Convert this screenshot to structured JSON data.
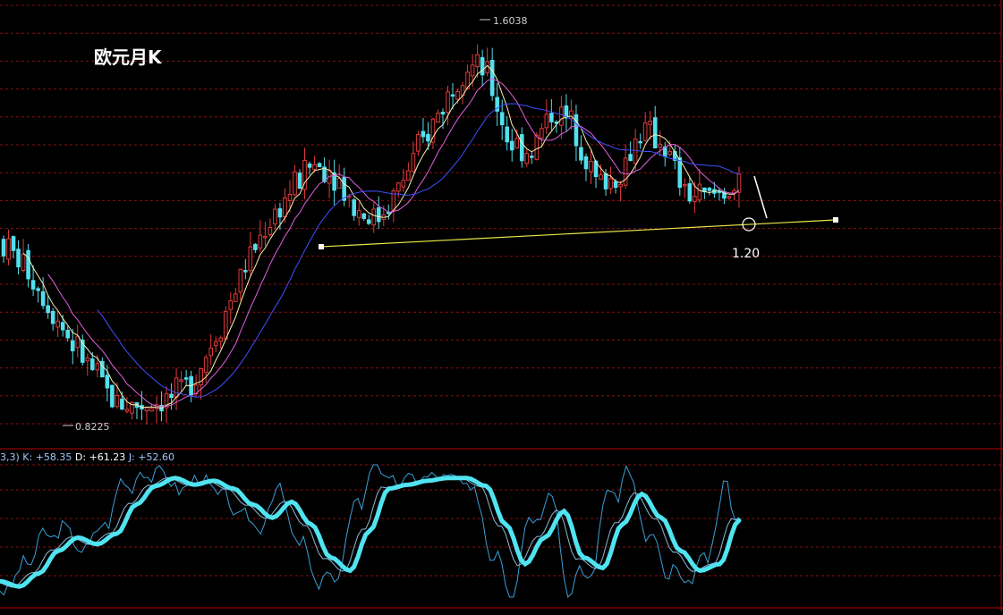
{
  "chart_data": [
    {
      "type": "candlestick",
      "title": "欧元月K",
      "ylim": [
        0.8,
        1.7
      ],
      "high_label": "1.6038",
      "low_label": "0.8225",
      "annotation_label": "1.20",
      "price_samples": [
        {
          "x": 0,
          "open": 1.18,
          "close": 1.16,
          "high": 1.2,
          "low": 1.12
        },
        {
          "x": 10,
          "open": 1.16,
          "close": 1.1,
          "high": 1.17,
          "low": 1.08
        },
        {
          "x": 20,
          "open": 1.1,
          "close": 1.02,
          "high": 1.12,
          "low": 1.0
        },
        {
          "x": 30,
          "open": 1.02,
          "close": 0.96,
          "high": 1.05,
          "low": 0.94
        },
        {
          "x": 40,
          "open": 0.96,
          "close": 0.9,
          "high": 0.98,
          "low": 0.86
        },
        {
          "x": 50,
          "open": 0.9,
          "close": 0.84,
          "high": 0.92,
          "low": 0.8225
        },
        {
          "x": 60,
          "open": 0.84,
          "close": 0.88,
          "high": 0.9,
          "low": 0.83
        },
        {
          "x": 70,
          "open": 0.88,
          "close": 0.86,
          "high": 0.9,
          "low": 0.84
        },
        {
          "x": 80,
          "open": 0.86,
          "close": 0.9,
          "high": 0.92,
          "low": 0.85
        },
        {
          "x": 90,
          "open": 0.9,
          "close": 0.98,
          "high": 1.0,
          "low": 0.88
        },
        {
          "x": 100,
          "open": 0.98,
          "close": 1.08,
          "high": 1.1,
          "low": 0.96
        },
        {
          "x": 110,
          "open": 1.08,
          "close": 1.18,
          "high": 1.2,
          "low": 1.06
        },
        {
          "x": 120,
          "open": 1.18,
          "close": 1.24,
          "high": 1.28,
          "low": 1.16
        },
        {
          "x": 130,
          "open": 1.24,
          "close": 1.3,
          "high": 1.34,
          "low": 1.2
        },
        {
          "x": 140,
          "open": 1.3,
          "close": 1.35,
          "high": 1.38,
          "low": 1.26
        },
        {
          "x": 150,
          "open": 1.35,
          "close": 1.28,
          "high": 1.38,
          "low": 1.22
        },
        {
          "x": 160,
          "open": 1.28,
          "close": 1.2,
          "high": 1.3,
          "low": 1.18
        },
        {
          "x": 170,
          "open": 1.2,
          "close": 1.24,
          "high": 1.28,
          "low": 1.18
        },
        {
          "x": 180,
          "open": 1.24,
          "close": 1.32,
          "high": 1.34,
          "low": 1.22
        },
        {
          "x": 190,
          "open": 1.32,
          "close": 1.4,
          "high": 1.44,
          "low": 1.3
        },
        {
          "x": 200,
          "open": 1.4,
          "close": 1.48,
          "high": 1.52,
          "low": 1.38
        },
        {
          "x": 210,
          "open": 1.48,
          "close": 1.56,
          "high": 1.6038,
          "low": 1.46
        },
        {
          "x": 220,
          "open": 1.56,
          "close": 1.44,
          "high": 1.58,
          "low": 1.4
        },
        {
          "x": 230,
          "open": 1.44,
          "close": 1.3,
          "high": 1.48,
          "low": 1.24
        },
        {
          "x": 240,
          "open": 1.3,
          "close": 1.4,
          "high": 1.44,
          "low": 1.28
        },
        {
          "x": 250,
          "open": 1.4,
          "close": 1.46,
          "high": 1.5,
          "low": 1.36
        },
        {
          "x": 260,
          "open": 1.46,
          "close": 1.34,
          "high": 1.48,
          "low": 1.3
        },
        {
          "x": 270,
          "open": 1.34,
          "close": 1.24,
          "high": 1.36,
          "low": 1.2
        },
        {
          "x": 280,
          "open": 1.24,
          "close": 1.36,
          "high": 1.38,
          "low": 1.22
        },
        {
          "x": 290,
          "open": 1.36,
          "close": 1.42,
          "high": 1.46,
          "low": 1.32
        },
        {
          "x": 300,
          "open": 1.42,
          "close": 1.32,
          "high": 1.44,
          "low": 1.28
        },
        {
          "x": 310,
          "open": 1.32,
          "close": 1.22,
          "high": 1.34,
          "low": 1.2
        },
        {
          "x": 320,
          "open": 1.22,
          "close": 1.3,
          "high": 1.32,
          "low": 1.2
        },
        {
          "x": 330,
          "open": 1.3,
          "close": 1.26,
          "high": 1.38,
          "low": 1.24
        },
        {
          "x": 335,
          "open": 1.26,
          "close": 1.29,
          "high": 1.31,
          "low": 1.25
        }
      ],
      "kdj": {
        "label_prefix": "3,3) ",
        "k_label": "K: +58.35",
        "d_label": "D: +61.23",
        "j_label": "J: +52.60",
        "ylim": [
          0,
          100
        ],
        "k_samples": [
          {
            "x": 0,
            "v": 12
          },
          {
            "x": 10,
            "v": 8
          },
          {
            "x": 20,
            "v": 18
          },
          {
            "x": 30,
            "v": 35
          },
          {
            "x": 40,
            "v": 45
          },
          {
            "x": 50,
            "v": 40
          },
          {
            "x": 60,
            "v": 48
          },
          {
            "x": 70,
            "v": 70
          },
          {
            "x": 80,
            "v": 84
          },
          {
            "x": 90,
            "v": 90
          },
          {
            "x": 100,
            "v": 85
          },
          {
            "x": 110,
            "v": 88
          },
          {
            "x": 120,
            "v": 82
          },
          {
            "x": 130,
            "v": 70
          },
          {
            "x": 140,
            "v": 60
          },
          {
            "x": 150,
            "v": 72
          },
          {
            "x": 160,
            "v": 55
          },
          {
            "x": 170,
            "v": 30
          },
          {
            "x": 180,
            "v": 20
          },
          {
            "x": 190,
            "v": 50
          },
          {
            "x": 200,
            "v": 82
          },
          {
            "x": 210,
            "v": 85
          },
          {
            "x": 220,
            "v": 88
          },
          {
            "x": 230,
            "v": 90
          },
          {
            "x": 240,
            "v": 90
          },
          {
            "x": 250,
            "v": 84
          },
          {
            "x": 260,
            "v": 55
          },
          {
            "x": 270,
            "v": 25
          },
          {
            "x": 280,
            "v": 45
          },
          {
            "x": 290,
            "v": 65
          },
          {
            "x": 300,
            "v": 30
          },
          {
            "x": 310,
            "v": 22
          },
          {
            "x": 320,
            "v": 55
          },
          {
            "x": 330,
            "v": 78
          },
          {
            "x": 340,
            "v": 60
          },
          {
            "x": 350,
            "v": 35
          },
          {
            "x": 360,
            "v": 20
          },
          {
            "x": 370,
            "v": 25
          },
          {
            "x": 380,
            "v": 58
          }
        ]
      }
    }
  ]
}
